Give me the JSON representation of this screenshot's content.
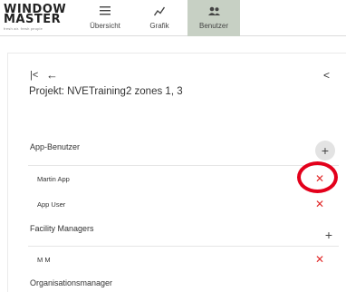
{
  "brand": {
    "line1": "Window",
    "line2": "Master",
    "tagline": "fresh air. fresh people"
  },
  "nav": [
    {
      "label": "Übersicht",
      "icon": "menu-icon"
    },
    {
      "label": "Grafik",
      "icon": "chart-line-icon"
    },
    {
      "label": "Benutzer",
      "icon": "users-icon",
      "active": true
    }
  ],
  "header": {
    "first_icon": "first-page-icon",
    "back_icon": "back-arrow-icon",
    "collapse_icon": "chevron-left-icon"
  },
  "project": {
    "title": "Projekt: NVETraining2 zones 1, 3"
  },
  "sections": {
    "app_users": {
      "title": "App-Benutzer",
      "items": [
        "Martin App",
        "App User"
      ]
    },
    "facility_managers": {
      "title": "Facility Managers",
      "items": [
        "M M"
      ]
    },
    "organisation_managers": {
      "title": "Organisationsmanager"
    }
  },
  "glyphs": {
    "add": "+",
    "remove": "✕",
    "first": "|<",
    "back": "←",
    "collapse": "<"
  },
  "colors": {
    "active_tab": "#c7d0c4",
    "remove": "#e12b2b",
    "highlight": "#e3001b"
  }
}
